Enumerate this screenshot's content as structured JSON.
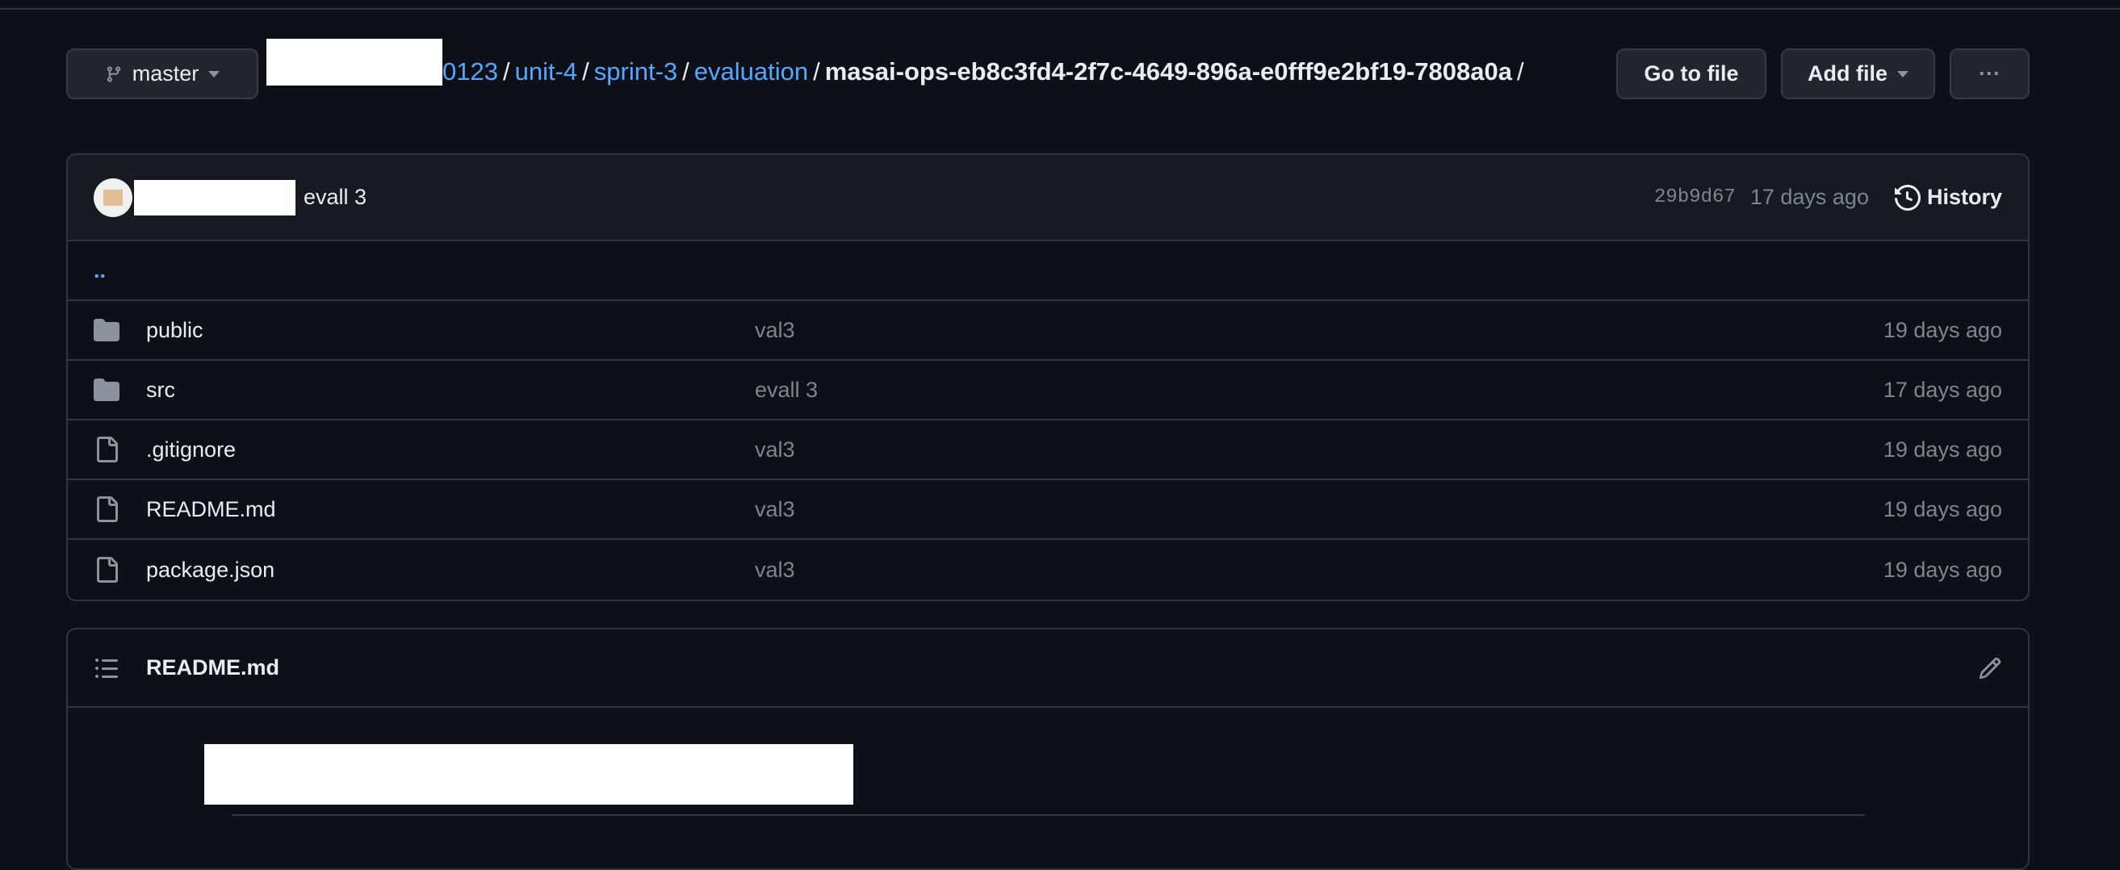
{
  "branch": {
    "label": "master",
    "icon": "git-branch-icon"
  },
  "breadcrumb": {
    "items": [
      "0123",
      "unit-4",
      "sprint-3",
      "evaluation"
    ],
    "current": "masai-ops-eb8c3fd4-2f7c-4649-896a-e0fff9e2bf19-7808a0a",
    "separator": "/"
  },
  "actions": {
    "go_to_file": "Go to file",
    "add_file": "Add file",
    "more": "···"
  },
  "commit": {
    "message": "evall 3",
    "sha": "29b9d67",
    "age": "17 days ago",
    "history": "History"
  },
  "parent": "..",
  "files": [
    {
      "name": "public",
      "type": "folder",
      "message": "val3",
      "age": "19 days ago"
    },
    {
      "name": "src",
      "type": "folder",
      "message": "evall 3",
      "age": "17 days ago"
    },
    {
      "name": ".gitignore",
      "type": "file",
      "message": "val3",
      "age": "19 days ago"
    },
    {
      "name": "README.md",
      "type": "file",
      "message": "val3",
      "age": "19 days ago"
    },
    {
      "name": "package.json",
      "type": "file",
      "message": "val3",
      "age": "19 days ago"
    }
  ],
  "readme": {
    "title": "README.md"
  },
  "colors": {
    "bg": "#0d1117",
    "link": "#58a6ff",
    "muted": "#7d8590",
    "border": "#30363d"
  }
}
